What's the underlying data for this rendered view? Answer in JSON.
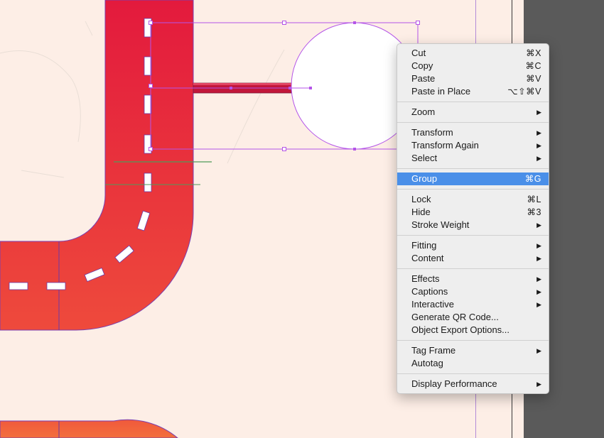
{
  "context_menu": {
    "groups": [
      [
        {
          "label": "Cut",
          "shortcut": "⌘X"
        },
        {
          "label": "Copy",
          "shortcut": "⌘C"
        },
        {
          "label": "Paste",
          "shortcut": "⌘V"
        },
        {
          "label": "Paste in Place",
          "shortcut": "⌥⇧⌘V"
        }
      ],
      [
        {
          "label": "Zoom",
          "submenu": true
        }
      ],
      [
        {
          "label": "Transform",
          "submenu": true
        },
        {
          "label": "Transform Again",
          "submenu": true
        },
        {
          "label": "Select",
          "submenu": true
        }
      ],
      [
        {
          "label": "Group",
          "shortcut": "⌘G",
          "highlighted": true
        }
      ],
      [
        {
          "label": "Lock",
          "shortcut": "⌘L"
        },
        {
          "label": "Hide",
          "shortcut": "⌘3"
        },
        {
          "label": "Stroke Weight",
          "submenu": true
        }
      ],
      [
        {
          "label": "Fitting",
          "submenu": true
        },
        {
          "label": "Content",
          "submenu": true
        }
      ],
      [
        {
          "label": "Effects",
          "submenu": true
        },
        {
          "label": "Captions",
          "submenu": true
        },
        {
          "label": "Interactive",
          "submenu": true
        },
        {
          "label": "Generate QR Code..."
        },
        {
          "label": "Object Export Options..."
        }
      ],
      [
        {
          "label": "Tag Frame",
          "submenu": true
        },
        {
          "label": "Autotag"
        }
      ],
      [
        {
          "label": "Display Performance",
          "submenu": true
        }
      ]
    ],
    "submenu_glyph": "▶"
  },
  "colors": {
    "page_background": "#fdeee6",
    "pasteboard": "#5a5a5a",
    "road_top": "#e31c3c",
    "road_bottom": "#ef4f3c",
    "road_lower": "#f26a3c",
    "selection": "#b454e8",
    "menu_highlight": "#4a8fe8"
  }
}
